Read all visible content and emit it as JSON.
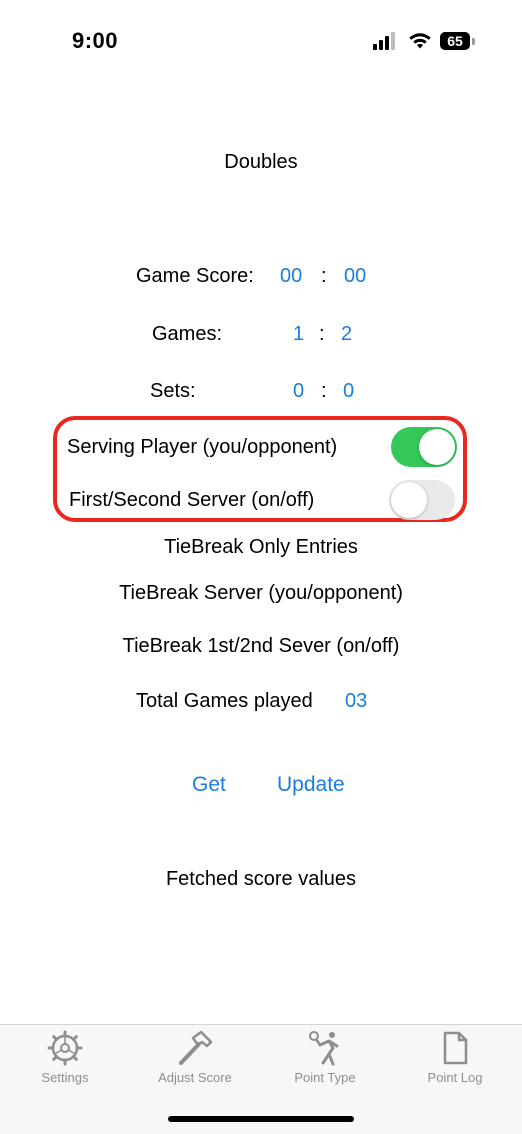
{
  "status_bar": {
    "time": "9:00",
    "battery": "65"
  },
  "header": {
    "title": "Doubles"
  },
  "scores": {
    "game_score": {
      "label": "Game Score:",
      "you": "00",
      "sep": ":",
      "opp": "00"
    },
    "games": {
      "label": "Games:",
      "you": "1",
      "sep": ":",
      "opp": "2"
    },
    "sets": {
      "label": "Sets:",
      "you": "0",
      "sep": ":",
      "opp": "0"
    }
  },
  "toggles": {
    "serving_player": {
      "label": "Serving Player (you/opponent)",
      "on": true
    },
    "first_second_server": {
      "label": "First/Second Server (on/off)",
      "on": false
    }
  },
  "tiebreak": {
    "heading": "TieBreak Only Entries",
    "server": "TieBreak Server (you/opponent)",
    "first_second": "TieBreak 1st/2nd Sever (on/off)"
  },
  "total_games": {
    "label": "Total Games played",
    "value": "03"
  },
  "actions": {
    "get": "Get",
    "update": "Update"
  },
  "status_text": "Fetched score values",
  "tabs": [
    {
      "label": "Settings",
      "icon": "gear-icon"
    },
    {
      "label": "Adjust Score",
      "icon": "hammer-icon"
    },
    {
      "label": "Point Type",
      "icon": "tennis-player-icon"
    },
    {
      "label": "Point Log",
      "icon": "document-icon"
    }
  ],
  "colors": {
    "accent": "#1a7ee0",
    "toggle_on": "#34c759",
    "highlight": "#e8281e"
  }
}
